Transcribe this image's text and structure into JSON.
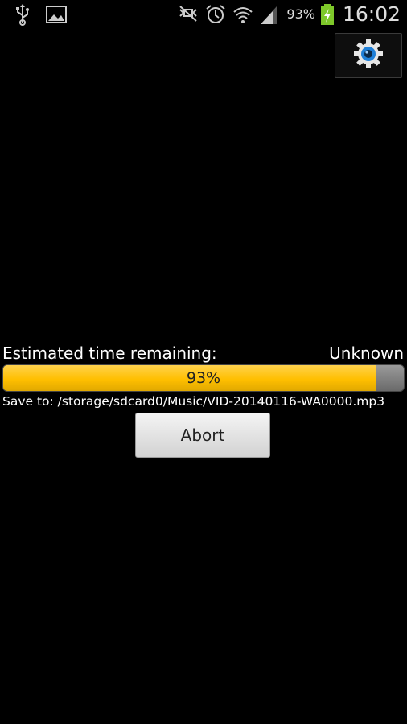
{
  "status_bar": {
    "battery_percent": "93%",
    "time": "16:02",
    "icons": [
      "usb-icon",
      "gallery-icon",
      "mute-icon",
      "alarm-icon",
      "wifi-icon",
      "signal-icon",
      "battery-charging-icon"
    ]
  },
  "toolbar": {
    "settings_icon": "gear-icon"
  },
  "download": {
    "eta_label": "Estimated time remaining:",
    "eta_value": "Unknown",
    "progress_percent": 93,
    "progress_label": "93%",
    "save_path": "Save to: /storage/sdcard0/Music/VID-20140116-WA0000.mp3",
    "abort_label": "Abort"
  },
  "colors": {
    "background": "#000000",
    "progress_fill": "#ffbf00",
    "progress_track": "#7a7a7a"
  }
}
